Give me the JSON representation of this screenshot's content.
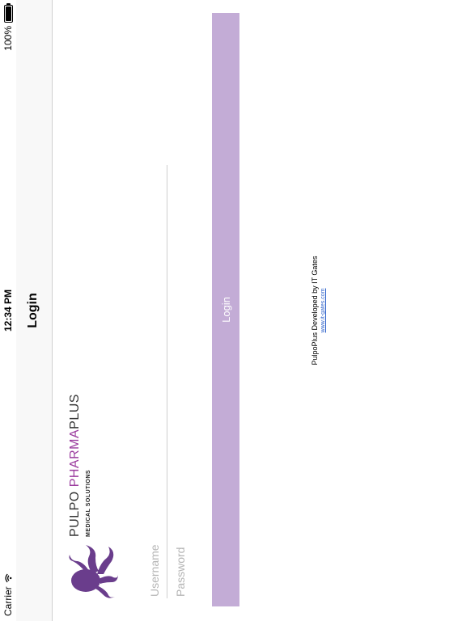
{
  "status_bar": {
    "carrier": "Carrier",
    "time": "12:34 PM",
    "battery": "100%",
    "battery_level": 1.0
  },
  "nav": {
    "title": "Login"
  },
  "logo": {
    "word_1": "PULPO",
    "word_2": "PHARMA",
    "word_3": "PLUS",
    "tagline": "MEDICAL   SOLUTIONS",
    "brand_color": "#9b3c9e"
  },
  "form": {
    "username_placeholder": "Username",
    "password_placeholder": "Password",
    "username_value": "",
    "password_value": "",
    "login_label": "Login",
    "button_color": "#c3acd6"
  },
  "footer": {
    "text": "PulpoPlus Developed by IT Gates",
    "link": "www.it-gates.com",
    "link_color": "#3366cc"
  },
  "icons": {
    "wifi": "wifi-icon",
    "battery": "battery-icon",
    "mascot": "octopus-icon"
  }
}
